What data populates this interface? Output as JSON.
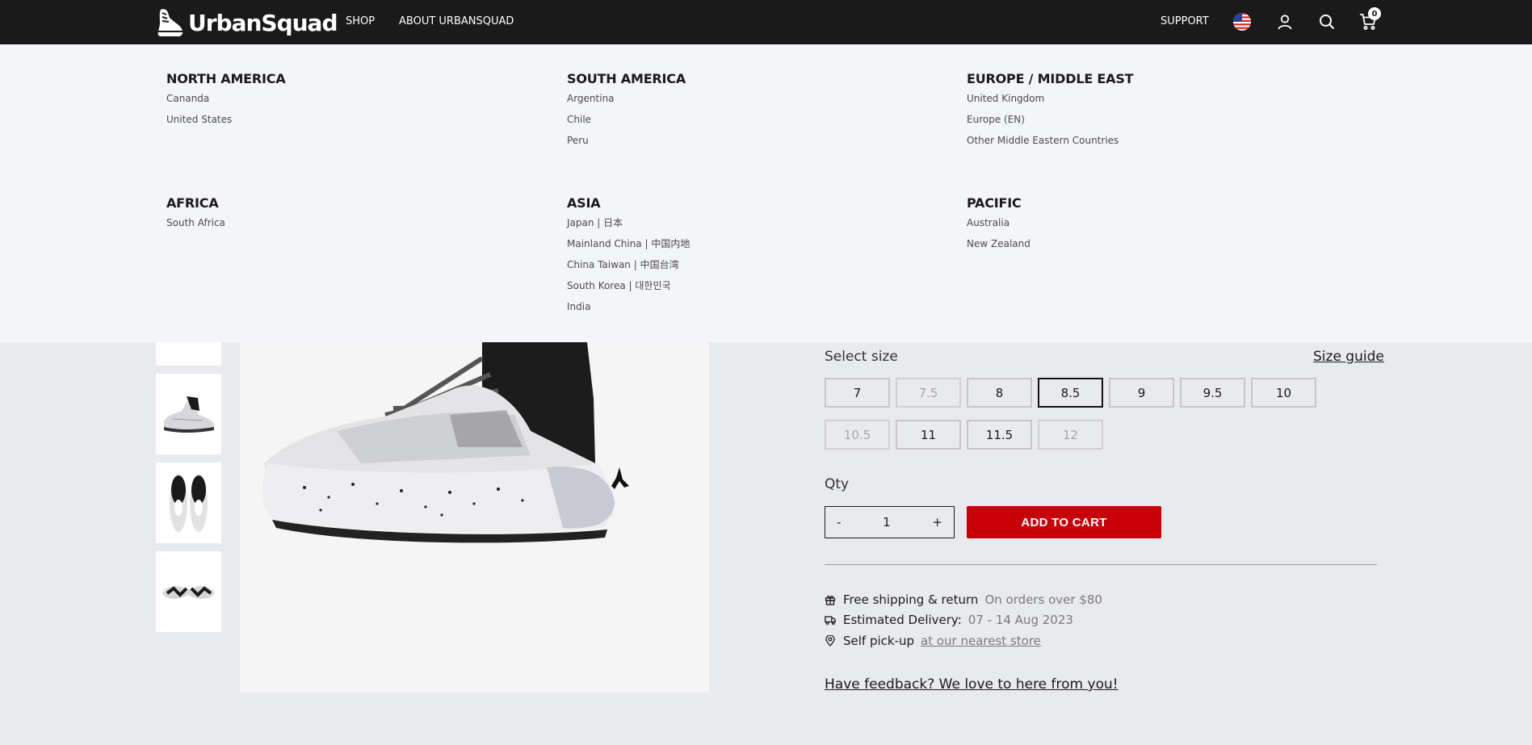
{
  "header": {
    "brand": "UrbanSquad",
    "nav": {
      "shop": "SHOP",
      "about": "ABOUT URBANSQUAD",
      "support": "SUPPORT"
    },
    "cart_count": "0",
    "icons": [
      "us-flag-icon",
      "user-icon",
      "search-icon",
      "cart-icon"
    ]
  },
  "regions": {
    "north_america": {
      "title": "NORTH AMERICA",
      "links": [
        "Cananda",
        "United States"
      ]
    },
    "south_america": {
      "title": "SOUTH AMERICA",
      "links": [
        "Argentina",
        "Chile",
        "Peru"
      ]
    },
    "europe": {
      "title": "EUROPE / MIDDLE EAST",
      "links": [
        "United Kingdom",
        "Europe (EN)",
        "Other Middle Eastern Countries"
      ]
    },
    "africa": {
      "title": "AFRICA",
      "links": [
        "South Africa"
      ]
    },
    "asia": {
      "title": "ASIA",
      "links": [
        "Japan | 日本",
        "Mainland China | 中国内地",
        "China Taiwan | 中国台湾",
        "South Korea | 대한민국",
        "India"
      ]
    },
    "pacific": {
      "title": "PACIFIC",
      "links": [
        "Australia",
        "New Zealand"
      ]
    }
  },
  "product": {
    "select_size_label": "Select size",
    "size_guide_label": "Size guide",
    "sizes": [
      {
        "label": "7",
        "state": "available"
      },
      {
        "label": "7.5",
        "state": "disabled"
      },
      {
        "label": "8",
        "state": "available"
      },
      {
        "label": "8.5",
        "state": "selected"
      },
      {
        "label": "9",
        "state": "available"
      },
      {
        "label": "9.5",
        "state": "available"
      },
      {
        "label": "10",
        "state": "available"
      },
      {
        "label": "10.5",
        "state": "disabled"
      },
      {
        "label": "11",
        "state": "available"
      },
      {
        "label": "11.5",
        "state": "available"
      },
      {
        "label": "12",
        "state": "disabled"
      }
    ],
    "qty_label": "Qty",
    "qty_minus": "-",
    "qty_value": "1",
    "qty_plus": "+",
    "add_to_cart": "ADD TO CART",
    "shipping": {
      "label": "Free shipping & return",
      "value": "On orders over $80"
    },
    "delivery": {
      "label": "Estimated Delivery:",
      "value": "07 - 14 Aug 2023"
    },
    "pickup": {
      "label": "Self pick-up",
      "value": "at our nearest store"
    },
    "feedback": "Have feedback? We love to here from you!"
  },
  "colors": {
    "header_bg": "#1a1a1a",
    "accent_red": "#c8000a",
    "page_bg": "#e9eaee",
    "menu_bg": "#f4f5f9"
  }
}
